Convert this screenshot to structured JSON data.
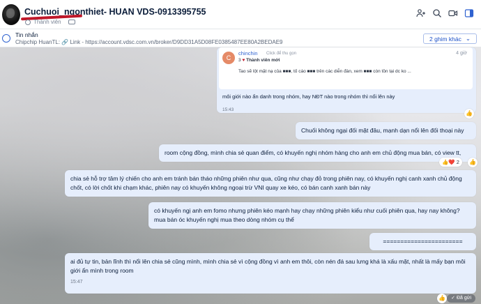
{
  "header": {
    "group_title": "Cuchuoi_ngonthiet- HUAN VDS-0913395755",
    "member_label": "Thành viên"
  },
  "pinned": {
    "title": "Tin nhắn",
    "body": "Chipchip HuanTL: 🔗 Link - https://account.vdsc.com.vn/broker/D9DD31A5D08FE0385487EE80A2BEDAE9",
    "more_button": "2 ghim khác"
  },
  "messages": {
    "quote": {
      "avatar_letter": "C",
      "name": "chinchin",
      "hint": "Click để thu gọn",
      "role_count": "3",
      "role": "Thành viên mới",
      "time_ago": "4 giờ",
      "line1": "Tao sẽ lột mặt nạ của ■■■, tố cáo ■■■ trên các diễn đàn, xem ■■■ còn tồn tại dc ko ...",
      "line2": "",
      "reply": "môi giới nào ẩn danh trong nhóm, hay NĐT nào trong nhóm thì nổi lên này",
      "time": "15:43"
    },
    "m1": "Chuối không ngại đối mặt đâu, mạnh dạn nổi lên đối thoại này",
    "m2": "room cộng đồng, mình chia sẻ quan điểm, có khuyến nghị nhóm hàng cho anh em chủ động mua bán, có view tt,",
    "m2_reactions": "👍❤️ 2",
    "m3": "chia sẻ hỗ trợ tâm lý chiến cho anh em tránh bán tháo những phiên như qua, cũng như chạy đỏ trong phiên nay, có khuyến nghị canh xanh chủ động chốt, có lời chốt khi chạm khác, phiên nay có khuyến không ngoại trừ VNI quay xe kéo, có bán canh xanh bán này",
    "m4": "có khuyến ngị anh em fomo nhưng phiên kéo mạnh  hay chạy những phiên kiểu như cuối phiên qua, hay nay không? mua bán óc khuyến nghị mua theo dòng nhóm cụ thể",
    "m5": "=======================",
    "m6": "ai đủ tự tin, bản lĩnh thì nổi lên chia sẻ cũng mình, mình chia sẻ vì cộng đồng vì anh em thôi, còn nén đá sau lưng khá là xấu mặt, nhất là mấy bạn môi giới ẩn mình trong room",
    "m6_time": "15:47",
    "sent_label": "✓ Đã gửi"
  },
  "colors": {
    "bubble": "#e6eefc",
    "accent": "#2f62d0",
    "brand_red": "#c0182a"
  }
}
